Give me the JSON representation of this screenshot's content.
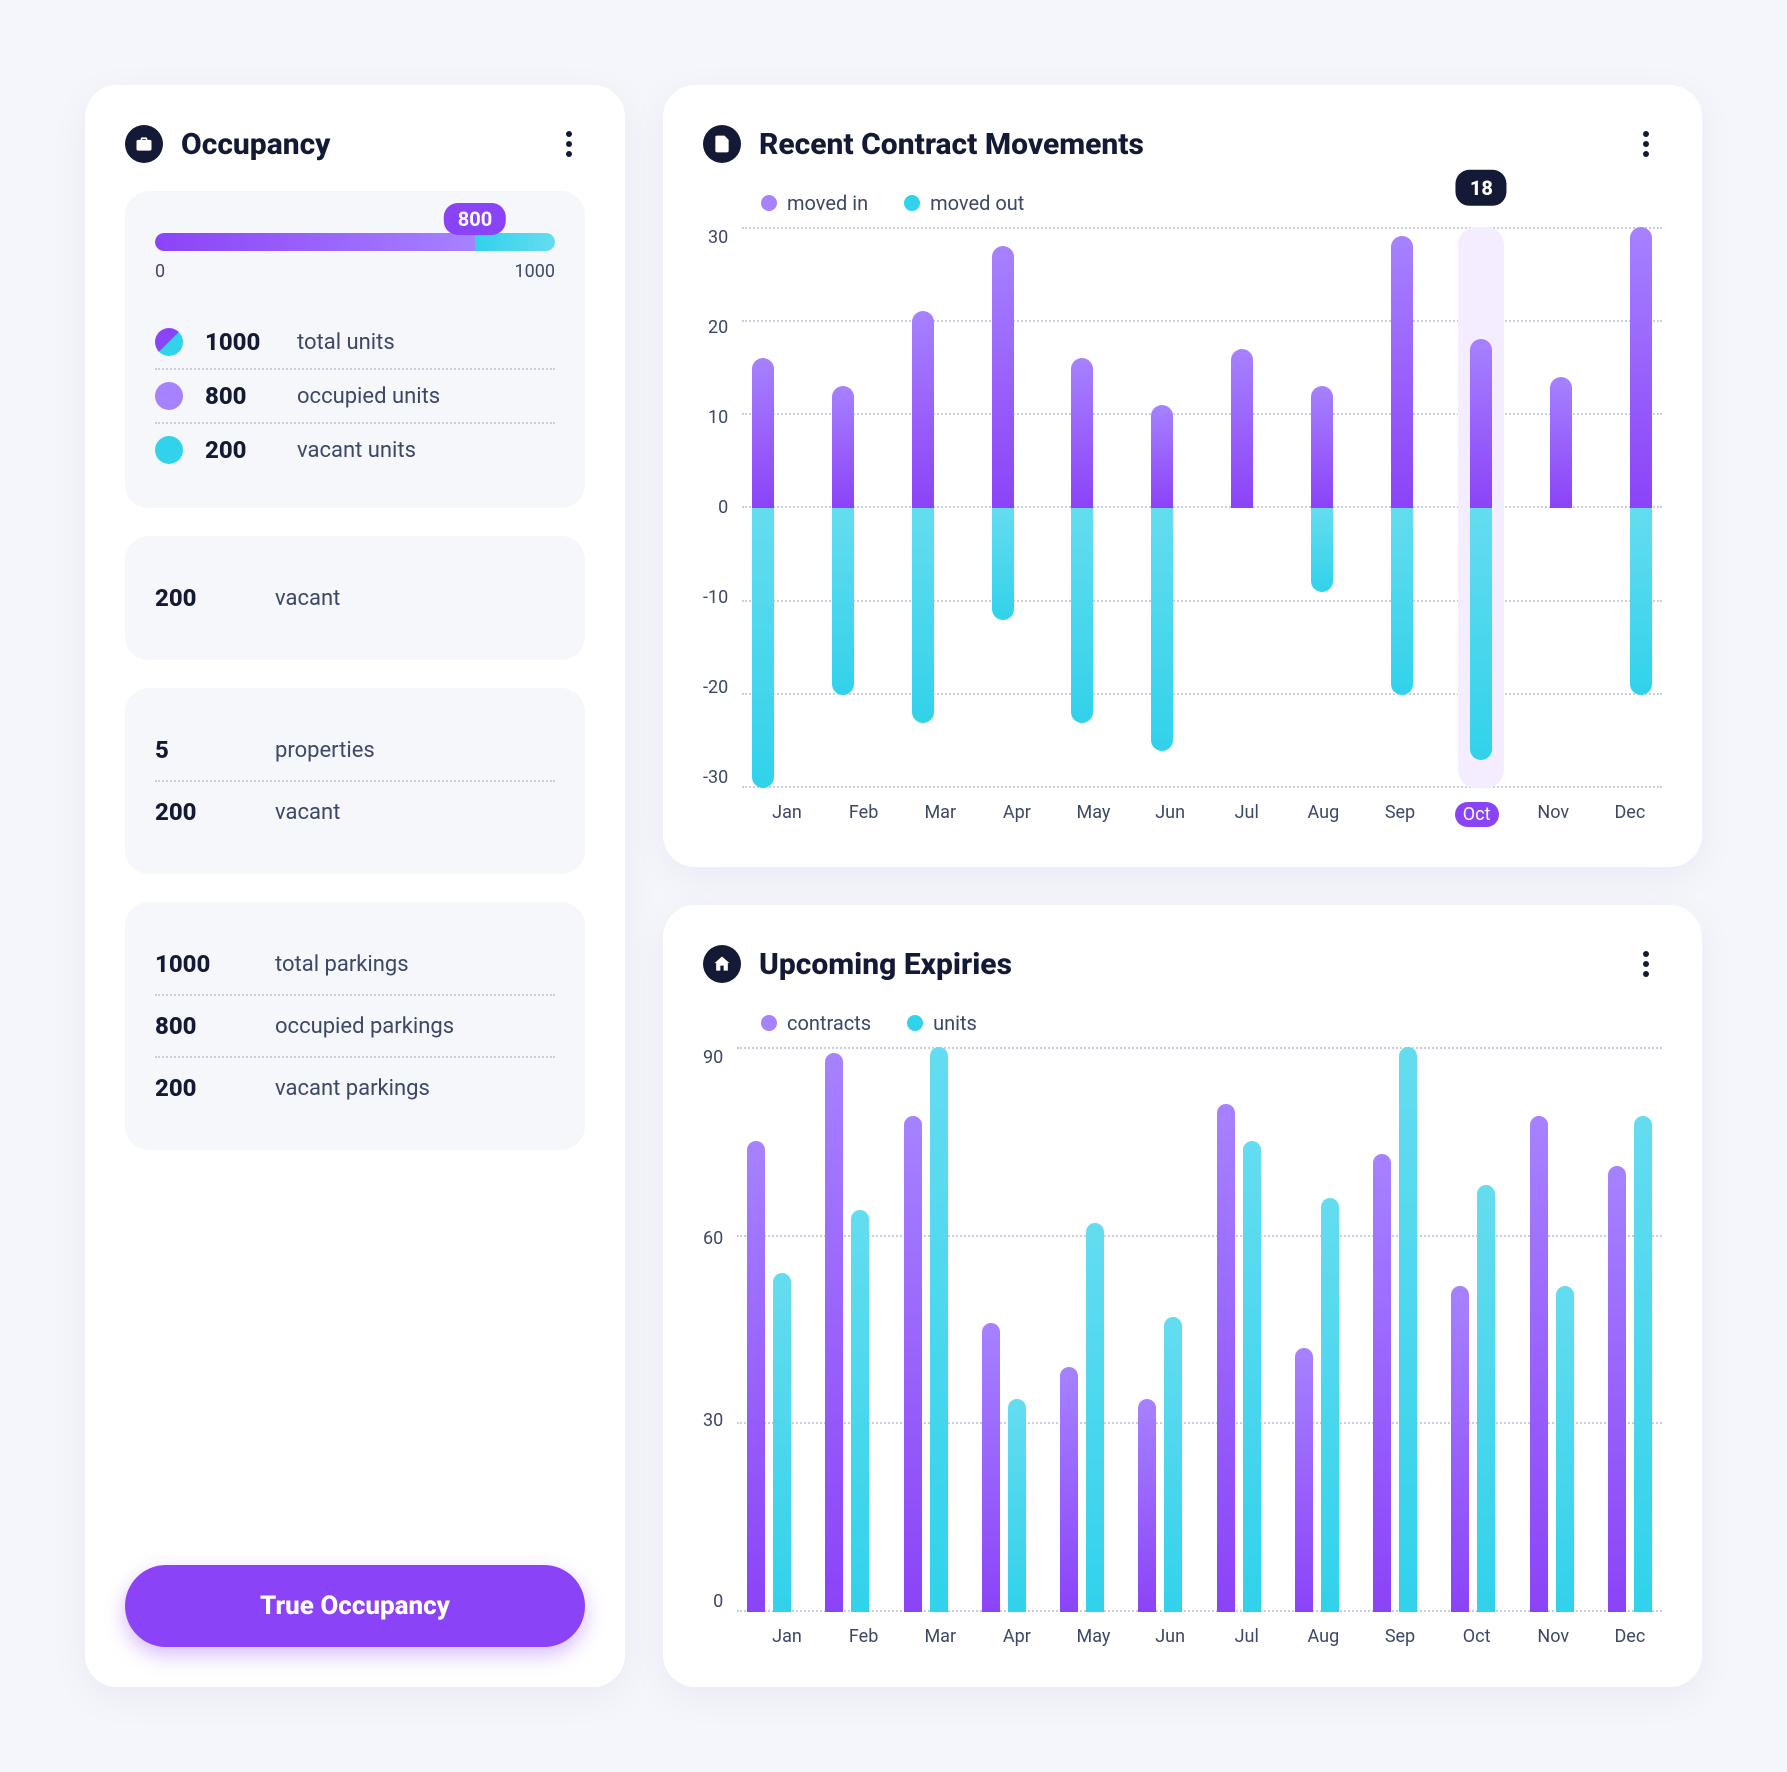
{
  "occupancy": {
    "title": "Occupancy",
    "progress": {
      "value": 800,
      "max": 1000,
      "label_min": "0",
      "label_max": "1000"
    },
    "units": [
      {
        "value": 1000,
        "label": "total units"
      },
      {
        "value": 800,
        "label": "occupied units"
      },
      {
        "value": 200,
        "label": "vacant units"
      }
    ],
    "block1": [
      {
        "value": 200,
        "label": "vacant"
      }
    ],
    "block2": [
      {
        "value": 5,
        "label": "properties"
      },
      {
        "value": 200,
        "label": "vacant"
      }
    ],
    "block3": [
      {
        "value": 1000,
        "label": "total parkings"
      },
      {
        "value": 800,
        "label": "occupied parkings"
      },
      {
        "value": 200,
        "label": "vacant parkings"
      }
    ],
    "button_label": "True Occupancy"
  },
  "movements": {
    "title": "Recent Contract Movements",
    "legend": {
      "a": "moved in",
      "b": "moved out"
    },
    "y_ticks": [
      "30",
      "20",
      "10",
      "0",
      "-10",
      "-20",
      "-30"
    ],
    "tooltip": {
      "index": 9,
      "value": 18
    }
  },
  "expiries": {
    "title": "Upcoming Expiries",
    "legend": {
      "a": "contracts",
      "b": "units"
    },
    "y_ticks": [
      "90",
      "60",
      "30",
      "0"
    ]
  },
  "chart_data": [
    {
      "type": "bar",
      "title": "Recent Contract Movements",
      "diverging": true,
      "categories": [
        "Jan",
        "Feb",
        "Mar",
        "Apr",
        "May",
        "Jun",
        "Jul",
        "Aug",
        "Sep",
        "Oct",
        "Nov",
        "Dec"
      ],
      "series": [
        {
          "name": "moved in",
          "values": [
            16,
            13,
            21,
            28,
            16,
            11,
            17,
            13,
            29,
            18,
            14,
            30
          ]
        },
        {
          "name": "moved out",
          "values": [
            -30,
            -20,
            -23,
            -12,
            -23,
            -26,
            0,
            -9,
            -20,
            -27,
            0,
            -20
          ]
        }
      ],
      "ylabel": "",
      "xlabel": "",
      "ylim": [
        -30,
        30
      ],
      "highlight": "Oct",
      "legend_colors": {
        "moved in": "#a682ff",
        "moved out": "#31d2eb"
      }
    },
    {
      "type": "bar",
      "title": "Upcoming Expiries",
      "categories": [
        "Jan",
        "Feb",
        "Mar",
        "Apr",
        "May",
        "Jun",
        "Jul",
        "Aug",
        "Sep",
        "Oct",
        "Nov",
        "Dec"
      ],
      "series": [
        {
          "name": "contracts",
          "values": [
            75,
            89,
            79,
            46,
            39,
            34,
            81,
            42,
            73,
            52,
            79,
            71
          ]
        },
        {
          "name": "units",
          "values": [
            54,
            64,
            90,
            34,
            62,
            47,
            75,
            66,
            90,
            68,
            52,
            79
          ]
        }
      ],
      "ylabel": "",
      "xlabel": "",
      "ylim": [
        0,
        90
      ],
      "legend_colors": {
        "contracts": "#a682ff",
        "units": "#31d2eb"
      }
    }
  ]
}
